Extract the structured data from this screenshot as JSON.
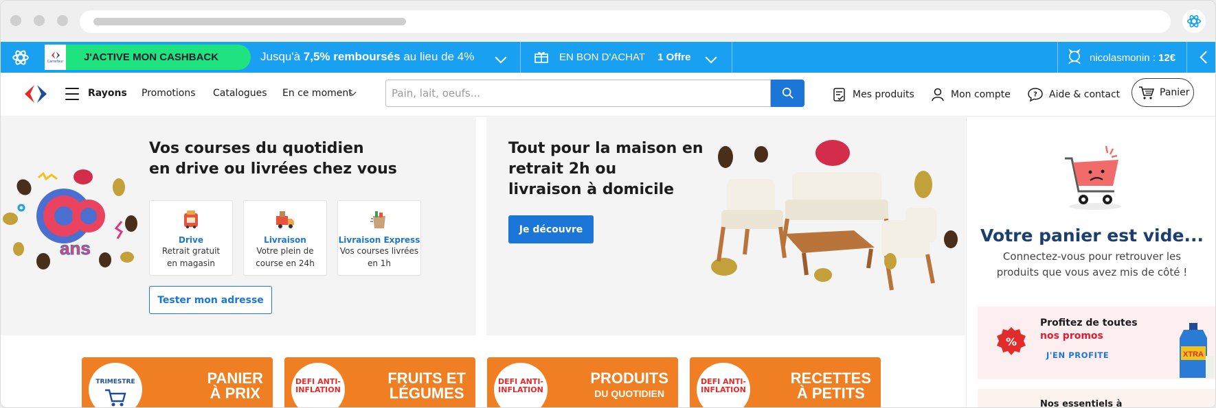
{
  "cashback_bar": {
    "cta_label": "J'ACTIVE MON CASHBACK",
    "offer_prefix": "Jusqu'à ",
    "offer_bold": "7,5% remboursés",
    "offer_suffix": " au lieu de 4%",
    "voucher_label": "EN BON D'ACHAT",
    "voucher_count": "1 Offre",
    "user_name": "nicolasmonin : ",
    "user_amount": "12€",
    "mini_logo_text": "Carrefour"
  },
  "header": {
    "rayons_label": "Rayons",
    "nav": [
      "Promotions",
      "Catalogues",
      "En ce moment"
    ],
    "search_placeholder": "Pain, lait, oeufs...",
    "mes_produits": "Mes produits",
    "mon_compte": "Mon compte",
    "aide_contact": "Aide & contact",
    "panier": "Panier"
  },
  "hero_left": {
    "title_line1": "Vos courses du quotidien",
    "title_line2": "en drive ou livrées chez vous",
    "badge_text": "ans",
    "services": [
      {
        "name": "Drive",
        "desc1": "Retrait gratuit",
        "desc2": "en magasin"
      },
      {
        "name": "Livraison",
        "desc1": "Votre plein de",
        "desc2": "course en 24h"
      },
      {
        "name": "Livraison Express",
        "desc1": "Vos courses livrées",
        "desc2": "en 1h"
      }
    ],
    "button_label": "Tester mon adresse"
  },
  "hero_right": {
    "title_line1": "Tout pour la maison en",
    "title_line2": "retrait 2h ou",
    "title_line3": "livraison à domicile",
    "button_label": "Je découvre"
  },
  "cart_panel": {
    "empty_title": "Votre panier est vide...",
    "empty_sub": "Connectez-vous pour retrouver les produits que vous avez mis de côté !",
    "promo_line1": "Profitez de toutes",
    "promo_line2": "nos promos",
    "promo_cta": "J'EN PROFITE",
    "promo_product": "XTRA",
    "essentials_line": "Nos essentiels à"
  },
  "tiles": [
    {
      "badge": "TRIMESTRE",
      "line1": "PANIER",
      "line2": "À PRIX"
    },
    {
      "badge": "DEFI ANTI-INFLATION",
      "line1": "FRUITS ET",
      "line2": "LÉGUMES"
    },
    {
      "badge": "DEFI ANTI-INFLATION",
      "line1": "PRODUITS",
      "line2": "DU QUOTIDIEN"
    },
    {
      "badge": "DEFI ANTI-INFLATION",
      "line1": "RECETTES",
      "line2": "À PETITS"
    }
  ],
  "colors": {
    "cashback_blue": "#19a0f0",
    "cashback_green": "#1ee37e",
    "brand_blue": "#1b76d8",
    "promo_red": "#e11d2f",
    "tile_orange": "#ef7f22",
    "empty_cart_title": "#1a3e6e"
  },
  "icons": [
    "cashback-extension-icon",
    "gift-icon",
    "user-avatar-icon",
    "carrefour-logo-icon",
    "menu-icon",
    "search-icon",
    "product-list-icon",
    "user-icon",
    "help-icon",
    "cart-icon",
    "drive-icon",
    "delivery-truck-icon",
    "express-bag-icon",
    "sad-cart-icon",
    "percent-badge-icon"
  ]
}
